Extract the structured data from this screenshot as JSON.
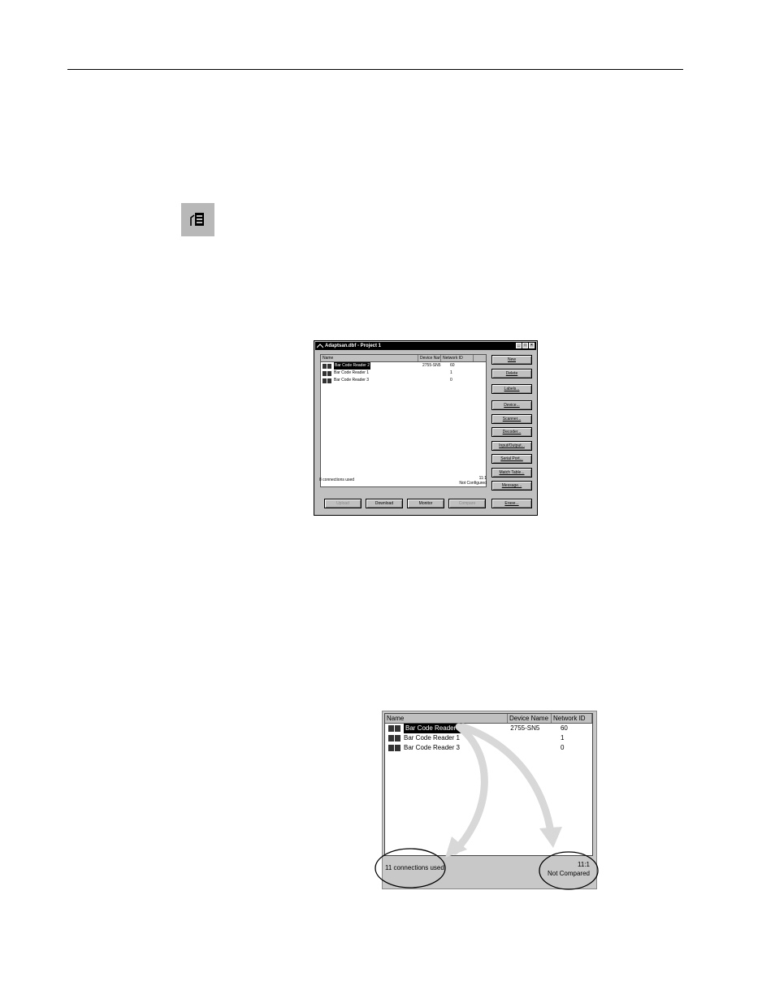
{
  "dialog": {
    "title": "Adaptsan.dbf - Project 1",
    "window_buttons": [
      "_",
      "□",
      "×"
    ],
    "columns": [
      "Name",
      "Device Name",
      "Network ID"
    ],
    "rows": [
      {
        "name": "Bar Code Reader 2",
        "device": "2755-SN5",
        "network_id": "60",
        "selected": true
      },
      {
        "name": "Bar Code Reader 1",
        "device": "",
        "network_id": "1",
        "selected": false
      },
      {
        "name": "Bar Code Reader 3",
        "device": "",
        "network_id": "0",
        "selected": false
      }
    ],
    "status_left": "8 connections used",
    "status_right_line1": "11:1",
    "status_right_line2": "Not Configured",
    "side_buttons": [
      "New",
      "Delete",
      "Labels...",
      "Device...",
      "Scanner...",
      "Decoder...",
      "Input/Output...",
      "Serial Port...",
      "Match Table...",
      "Message...",
      "Erase..."
    ],
    "bottom_buttons": [
      "Upload",
      "Download",
      "Monitor",
      "Compare"
    ]
  },
  "zoom": {
    "columns": [
      "Name",
      "Device Name",
      "Network ID"
    ],
    "rows": [
      {
        "name": "Bar Code Reader 2",
        "device": "2755-SN5",
        "network_id": "60",
        "selected": true
      },
      {
        "name": "Bar Code Reader 1",
        "device": "",
        "network_id": "1",
        "selected": false
      },
      {
        "name": "Bar Code Reader 3",
        "device": "",
        "network_id": "0",
        "selected": false
      }
    ],
    "status_left": "11 connections used",
    "status_right_line1": "11:1",
    "status_right_line2": "Not Compared"
  }
}
